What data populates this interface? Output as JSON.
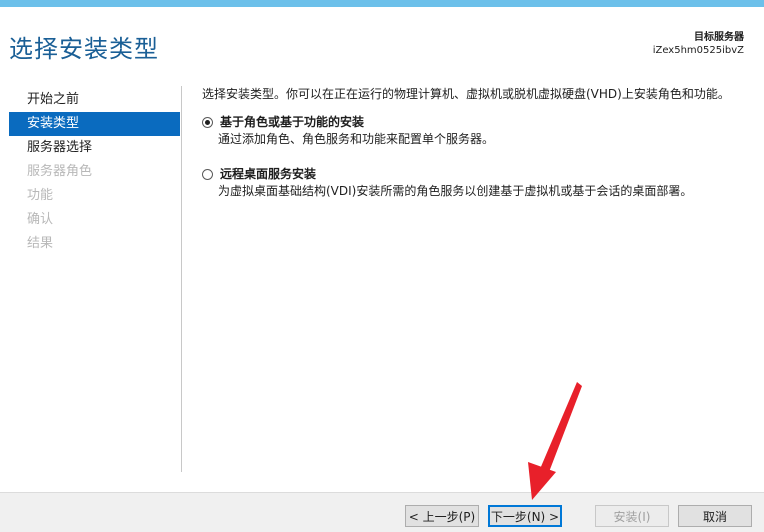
{
  "page": {
    "title": "选择安装类型",
    "server_label": "目标服务器",
    "server_name": "iZex5hm0525ibvZ"
  },
  "nav": {
    "items": [
      {
        "label": "开始之前",
        "state": "normal"
      },
      {
        "label": "安装类型",
        "state": "active"
      },
      {
        "label": "服务器选择",
        "state": "normal"
      },
      {
        "label": "服务器角色",
        "state": "disabled"
      },
      {
        "label": "功能",
        "state": "disabled"
      },
      {
        "label": "确认",
        "state": "disabled"
      },
      {
        "label": "结果",
        "state": "disabled"
      }
    ]
  },
  "content": {
    "intro": "选择安装类型。你可以在正在运行的物理计算机、虚拟机或脱机虚拟硬盘(VHD)上安装角色和功能。",
    "options": [
      {
        "label": "基于角色或基于功能的安装",
        "desc": "通过添加角色、角色服务和功能来配置单个服务器。",
        "selected": true
      },
      {
        "label": "远程桌面服务安装",
        "desc": "为虚拟桌面基础结构(VDI)安装所需的角色服务以创建基于虚拟机或基于会话的桌面部署。",
        "selected": false
      }
    ]
  },
  "footer": {
    "prev_label": "< 上一步(P)",
    "next_label": "下一步(N) >",
    "install_label": "安装(I)",
    "cancel_label": "取消"
  },
  "colors": {
    "title": "#1a5f96",
    "nav_active": "#0a6bbf",
    "annotation_arrow": "#e8202a"
  }
}
